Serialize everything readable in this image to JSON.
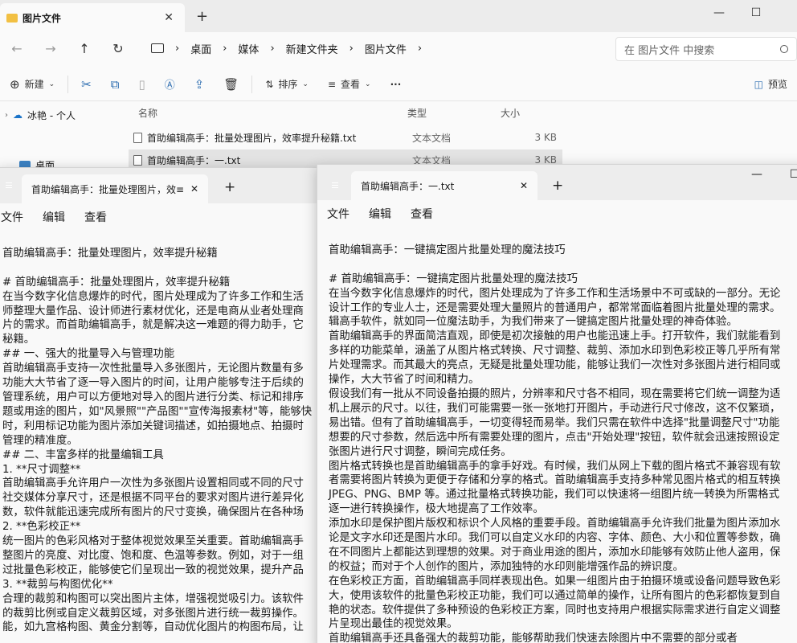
{
  "explorer": {
    "tab_title": "图片文件",
    "tab_close": "✕",
    "tab_new": "+",
    "window_buttons": [
      "—",
      "☐",
      "✕"
    ],
    "nav_buttons": {
      "back": "←",
      "forward": "→",
      "up": "↑",
      "refresh": "↻"
    },
    "breadcrumb": [
      "桌面",
      "媒体",
      "新建文件夹",
      "图片文件"
    ],
    "breadcrumb_sep": "›",
    "search_placeholder": "在 图片文件 中搜索",
    "toolbar": {
      "new": "新建",
      "sort": "排序",
      "view": "查看",
      "more": "···",
      "preview": "预览"
    },
    "nav_pane": [
      {
        "label": "冰艳 - 个人",
        "icon": "cloud-icon"
      },
      {
        "label": "桌面",
        "icon": "desktop-icon"
      }
    ],
    "columns": {
      "name": "名称",
      "type": "类型",
      "size": "大小"
    },
    "files": [
      {
        "name": "首助编辑高手：批量处理图片，效率提升秘籍.txt",
        "type": "文本文档",
        "size": "3 KB"
      },
      {
        "name": "首助编辑高手：一.txt",
        "type": "文本文档",
        "size": "3 KB"
      }
    ]
  },
  "notepad_left": {
    "tab_title": "首助编辑高手：批量处理图片，效≡",
    "tab_close": "✕",
    "tab_new": "+",
    "menu": [
      "文件",
      "编辑",
      "查看"
    ],
    "lines": [
      "",
      "首助编辑高手：批量处理图片，效率提升秘籍",
      "",
      "# 首助编辑高手：批量处理图片，效率提升秘籍",
      "在当今数字化信息爆炸的时代，图片处理成为了许多工作和生活",
      "师整理大量作品、设计师进行素材优化，还是电商从业者处理商",
      "片的需求。而首助编辑高手，就是解决这一难题的得力助手，它",
      "秘籍。",
      "## 一、强大的批量导入与管理功能",
      "首助编辑高手支持一次性批量导入多张图片，无论图片数量有多",
      "功能大大节省了逐一导入图片的时间，让用户能够专注于后续的",
      "管理系统，用户可以方便地对导入的图片进行分类、标记和排序",
      "题或用途的图片，如\"风景照\"\"产品图\"\"宣传海报素材\"等，能够快",
      "时，利用标记功能为图片添加关键词描述，如拍摄地点、拍摄时",
      "管理的精准度。",
      "## 二、丰富多样的批量编辑工具",
      "1. **尺寸调整**",
      "首助编辑高手允许用户一次性为多张图片设置相同或不同的尺寸",
      "社交媒体分享尺寸，还是根据不同平台的要求对图片进行差异化",
      "数，软件就能迅速完成所有图片的尺寸变换，确保图片在各种场",
      "2. **色彩校正**",
      "统一图片的色彩风格对于整体视觉效果至关重要。首助编辑高手",
      "整图片的亮度、对比度、饱和度、色温等参数。例如，对于一组",
      "过批量色彩校正，能够使它们呈现出一致的视觉效果，提升产品",
      "3. **裁剪与构图优化**",
      "合理的裁剪和构图可以突出图片主体，增强视觉吸引力。该软件",
      "的裁剪比例或自定义裁剪区域，对多张图片进行统一裁剪操作。",
      "能，如九宫格构图、黄金分割等，自动优化图片的构图布局，让"
    ]
  },
  "notepad_right": {
    "tab_title": "首助编辑高手：一.txt",
    "tab_close": "✕",
    "tab_new": "+",
    "window_buttons": [
      "—",
      "☐"
    ],
    "menu": [
      "文件",
      "编辑",
      "查看"
    ],
    "lines": [
      "",
      "首助编辑高手：一键搞定图片批量处理的魔法技巧",
      "",
      "# 首助编辑高手：一键搞定图片批量处理的魔法技巧",
      "在当今数字化信息爆炸的时代，图片处理成为了许多工作和生活场景中不可或缺的一部分。无论",
      "设计工作的专业人士，还是需要处理大量照片的普通用户，都常常面临着图片批量处理的需求。",
      "辑高手软件，就如同一位魔法助手，为我们带来了一键搞定图片批量处理的神奇体验。",
      "首助编辑高手的界面简洁直观，即使是初次接触的用户也能迅速上手。打开软件，我们就能看到",
      "多样的功能菜单，涵盖了从图片格式转换、尺寸调整、裁剪、添加水印到色彩校正等几乎所有常",
      "片处理需求。而其最大的亮点，无疑是批量处理功能，能够让我们一次性对多张图片进行相同或",
      "操作，大大节省了时间和精力。",
      "假设我们有一批从不同设备拍摄的照片，分辨率和尺寸各不相同，现在需要将它们统一调整为适",
      "机上展示的尺寸。以往，我们可能需要一张一张地打开图片，手动进行尺寸修改，这不仅繁琐，",
      "易出错。但有了首助编辑高手，一切变得轻而易举。我们只需在软件中选择\"批量调整尺寸\"功能",
      "想要的尺寸参数，然后选中所有需要处理的图片，点击\"开始处理\"按钮，软件就会迅速按照设定",
      "张图片进行尺寸调整，瞬间完成任务。",
      "图片格式转换也是首助编辑高手的拿手好戏。有时候，我们从网上下载的图片格式不兼容现有软",
      "者需要将图片转换为更便于存储和分享的格式。首助编辑高手支持多种常见图片格式的相互转换",
      "JPEG、PNG、BMP 等。通过批量格式转换功能，我们可以快速将一组图片统一转换为所需格式",
      "逐一进行转换操作，极大地提高了工作效率。",
      "添加水印是保护图片版权和标识个人风格的重要手段。首助编辑高手允许我们批量为图片添加水",
      "论是文字水印还是图片水印。我们可以自定义水印的内容、字体、颜色、大小和位置等参数，确",
      "在不同图片上都能达到理想的效果。对于商业用途的图片，添加水印能够有效防止他人盗用，保",
      "的权益；而对于个人创作的图片，添加独特的水印则能增强作品的辨识度。",
      "在色彩校正方面，首助编辑高手同样表现出色。如果一组图片由于拍摄环境或设备问题导致色彩",
      "大，使用该软件的批量色彩校正功能，我们可以通过简单的操作，让所有图片的色彩都恢复到自",
      "艳的状态。软件提供了多种预设的色彩校正方案，同时也支持用户根据实际需求进行自定义调整",
      "片呈现出最佳的视觉效果。",
      "首助编辑高手还具备强大的裁剪功能，能够帮助我们快速去除图片中不需要的部分或者"
    ]
  }
}
